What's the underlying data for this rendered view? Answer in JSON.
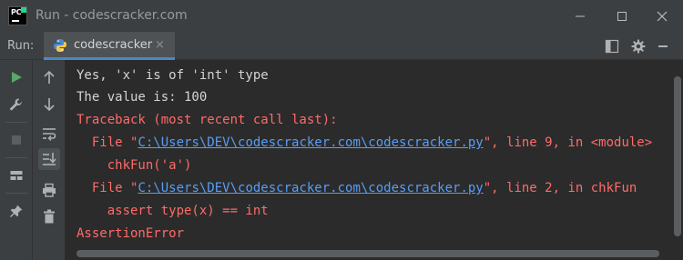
{
  "window": {
    "logo_text": "PC",
    "title": "Run - codescracker.com"
  },
  "run_panel": {
    "label": "Run:",
    "tab_label": "codescracker",
    "tab_close": "×"
  },
  "console": {
    "line1": "Yes, 'x' is of 'int' type",
    "line2": "The value is: 100",
    "line3": "Traceback (most recent call last):",
    "frame1_prefix": "  File \"",
    "frame1_path": "C:\\Users\\DEV\\codescracker.com\\codescracker.py",
    "frame1_suffix": "\", line 9, in <module>",
    "frame1_code": "    chkFun('a')",
    "frame2_prefix": "  File \"",
    "frame2_path": "C:\\Users\\DEV\\codescracker.com\\codescracker.py",
    "frame2_suffix": "\", line 2, in chkFun",
    "frame2_code": "    assert type(x) == int",
    "error_line": "AssertionError"
  },
  "colors": {
    "stdout": "#d4d4d4",
    "stderr": "#ff6b68",
    "link": "#589df6",
    "run_green": "#59a869"
  },
  "icons": {
    "toolbar_left": [
      "run-icon",
      "wrench-icon",
      "stop-icon",
      "layout-icon",
      "pin-icon"
    ],
    "toolbar_right": [
      "arrow-up-icon",
      "arrow-down-icon",
      "soft-wrap-icon",
      "scroll-to-end-icon",
      "print-icon",
      "trash-icon"
    ]
  }
}
